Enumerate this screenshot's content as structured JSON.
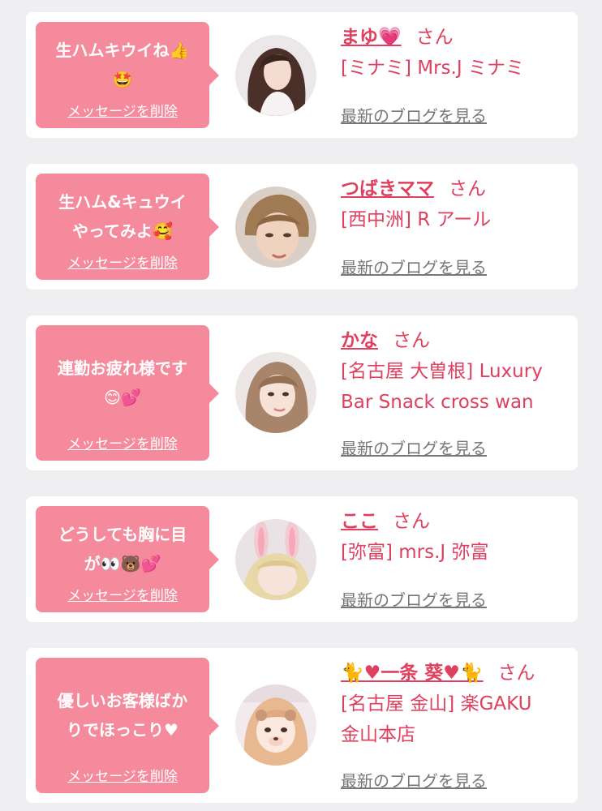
{
  "cards": [
    {
      "message": "生ハムキウイね👍\n🤩",
      "delete_label": "メッセージを削除",
      "name": "まゆ💗",
      "honorific": "さん",
      "shop": "[ミナミ] Mrs.J ミナミ",
      "blog_link": "最新のブログを見る"
    },
    {
      "message": "生ハム&キュウイ\nやってみよ🥰",
      "delete_label": "メッセージを削除",
      "name": "つばきママ",
      "honorific": "さん",
      "shop": "[西中洲] R アール",
      "blog_link": "最新のブログを見る"
    },
    {
      "message": "連勤お疲れ様です\n😊💕",
      "delete_label": "メッセージを削除",
      "name": "かな",
      "honorific": "さん",
      "shop": "[名古屋 大曽根] Luxury\nBar Snack cross wan",
      "blog_link": "最新のブログを見る"
    },
    {
      "message": "どうしても胸に目\nが👀🐻💕",
      "delete_label": "メッセージを削除",
      "name": "ここ",
      "honorific": "さん",
      "shop": "[弥富] mrs.J 弥富",
      "blog_link": "最新のブログを見る"
    },
    {
      "message": "優しいお客様ばか\nりでほっこり♥",
      "delete_label": "メッセージを削除",
      "name": "🐈♥一条 葵♥🐈",
      "honorific": "さん",
      "shop": "[名古屋 金山] 楽GAKU\n金山本店",
      "blog_link": "最新のブログを見る"
    }
  ]
}
